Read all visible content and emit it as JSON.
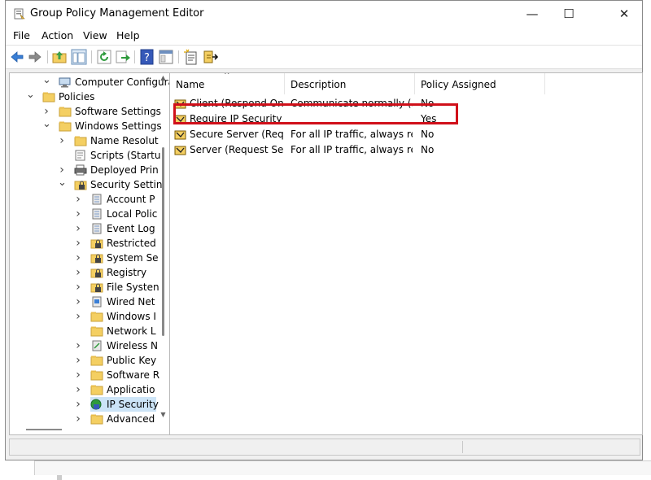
{
  "window": {
    "title": "Group Policy Management Editor",
    "minimize_glyph": "—",
    "maximize_glyph": "☐",
    "close_glyph": "✕"
  },
  "menu": [
    "File",
    "Action",
    "View",
    "Help"
  ],
  "toolbar": {
    "buttons": [
      "back-arrow-icon",
      "forward-arrow-icon",
      "up-folder-icon",
      "show-hide-tree-icon",
      "refresh-icon",
      "export-list-icon",
      "help-icon",
      "properties-icon",
      "new-policy-icon",
      "assign-policy-icon"
    ]
  },
  "tree": {
    "items": [
      {
        "label": "Computer Configuration",
        "icon": "computer-icon",
        "expanded": true
      },
      {
        "label": "Policies",
        "icon": "folder-icon",
        "expanded": true
      },
      {
        "label": "Software Settings",
        "icon": "folder-icon",
        "expanded": false
      },
      {
        "label": "Windows Settings",
        "icon": "folder-icon",
        "expanded": true
      },
      {
        "label": "Name Resolut",
        "icon": "folder-icon",
        "expanded": false
      },
      {
        "label": "Scripts (Startu",
        "icon": "scripts-icon",
        "expanded": null
      },
      {
        "label": "Deployed Prin",
        "icon": "printer-icon",
        "expanded": false
      },
      {
        "label": "Security Settin",
        "icon": "security-icon",
        "expanded": true
      },
      {
        "label": "Account P",
        "icon": "account-policy-icon",
        "expanded": false
      },
      {
        "label": "Local Polic",
        "icon": "local-policy-icon",
        "expanded": false
      },
      {
        "label": "Event Log",
        "icon": "event-log-icon",
        "expanded": false
      },
      {
        "label": "Restricted",
        "icon": "restricted-groups-icon",
        "expanded": false
      },
      {
        "label": "System Se",
        "icon": "system-services-icon",
        "expanded": false
      },
      {
        "label": "Registry",
        "icon": "registry-icon",
        "expanded": false
      },
      {
        "label": "File Systen",
        "icon": "file-system-icon",
        "expanded": false
      },
      {
        "label": "Wired Net",
        "icon": "wired-network-icon",
        "expanded": false
      },
      {
        "label": "Windows I",
        "icon": "folder-icon",
        "expanded": false
      },
      {
        "label": "Network L",
        "icon": "folder-icon",
        "expanded": null
      },
      {
        "label": "Wireless N",
        "icon": "wireless-network-icon",
        "expanded": false
      },
      {
        "label": "Public Key",
        "icon": "folder-icon",
        "expanded": false
      },
      {
        "label": "Software R",
        "icon": "folder-icon",
        "expanded": false
      },
      {
        "label": "Applicatio",
        "icon": "folder-icon",
        "expanded": false
      },
      {
        "label": "IP Security",
        "icon": "ip-security-icon",
        "expanded": false,
        "selected": true
      },
      {
        "label": "Advanced",
        "icon": "folder-icon",
        "expanded": false
      }
    ]
  },
  "list": {
    "sort_glyph": "^",
    "columns": [
      "Name",
      "Description",
      "Policy Assigned"
    ],
    "rows": [
      {
        "name": "Client (Respond Only)",
        "description": "Communicate normally (...",
        "assigned": "No"
      },
      {
        "name": "Require IP Security E...",
        "description": "",
        "assigned": "Yes"
      },
      {
        "name": "Secure Server (Requi...",
        "description": "For all IP traffic, always re...",
        "assigned": "No"
      },
      {
        "name": "Server (Request Sec...",
        "description": "For all IP traffic, always re...",
        "assigned": "No"
      }
    ]
  },
  "colors": {
    "selection": "#cce4f7",
    "highlight_border": "#d0101a",
    "folder": "#f4cf62"
  }
}
